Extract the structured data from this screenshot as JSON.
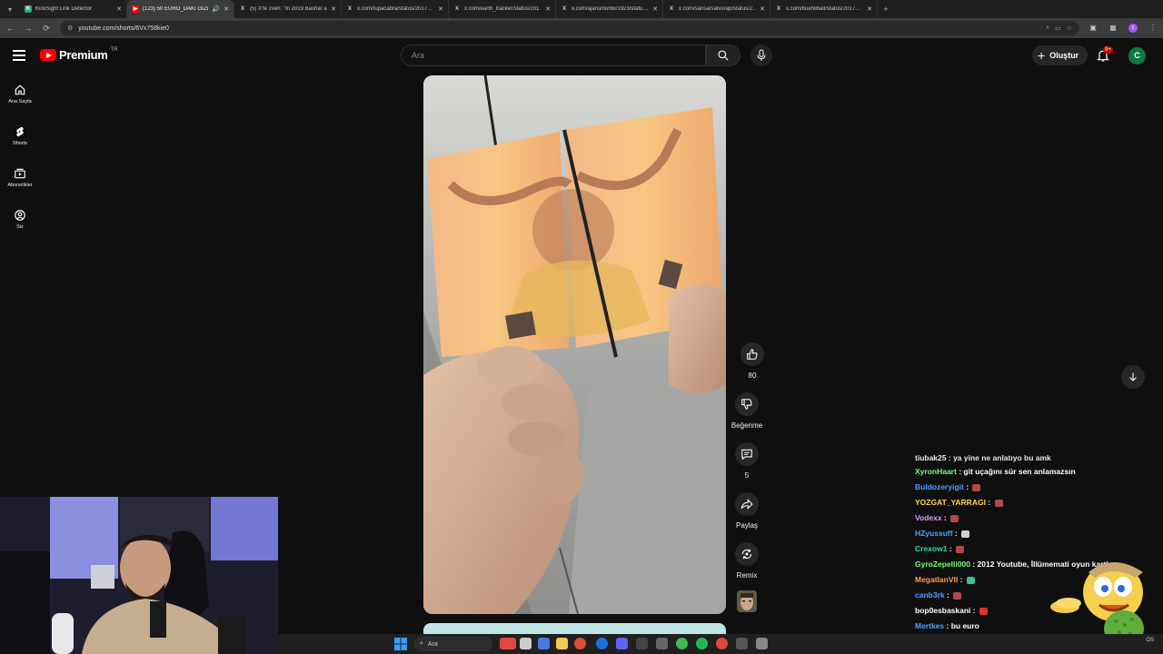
{
  "browser": {
    "tabs": [
      {
        "title": "KickSight Link Detector",
        "favicon": "K",
        "active": false
      },
      {
        "title": "(123) 50 EURO_DAKİ GİZLİ",
        "favicon": "▶",
        "active": true
      },
      {
        "title": "(5) X'te zven: \"In 2019 Bashar al",
        "favicon": "X",
        "active": false
      },
      {
        "title": "x.com/tupacabra/status/2017…",
        "favicon": "X",
        "active": false
      },
      {
        "title": "x.com/earth_tracker/status/201…",
        "favicon": "X",
        "active": false
      },
      {
        "title": "x.com/ajansmuhbir1923/statu…",
        "favicon": "X",
        "active": false
      },
      {
        "title": "x.com/sansarsalvorap/status/2…",
        "favicon": "X",
        "active": false
      },
      {
        "title": "x.com/buehlibait/status/2017…",
        "favicon": "X",
        "active": false
      }
    ],
    "new_tab": "+",
    "url": "youtube.com/shorts/6Vx758kie0"
  },
  "youtube": {
    "brand": "Premium",
    "region": "TR",
    "search_placeholder": "Ara",
    "create_label": "Oluştur",
    "notif_badge": "9+",
    "avatar_letter": "C"
  },
  "sidebar": {
    "items": [
      {
        "label": "Ana Sayfa",
        "icon": "home-icon"
      },
      {
        "label": "Shorts",
        "icon": "shorts-icon"
      },
      {
        "label": "Abonelikler",
        "icon": "subscriptions-icon"
      },
      {
        "label": "Siz",
        "icon": "you-icon"
      }
    ]
  },
  "actions": {
    "like_count": "80",
    "dislike_label": "Beğenme",
    "comment_count": "5",
    "share_label": "Paylaş",
    "remix_label": "Remix"
  },
  "chat": {
    "messages": [
      {
        "user": "tiubak25",
        "text": "ya yine ne anlatıyo bu amk",
        "color": "#ffffff",
        "emote": false
      },
      {
        "user": "XyronHaart",
        "text": "git uçağını sür sen anlamazsın",
        "color": "#7cfc7c",
        "emote": false
      },
      {
        "user": "Buldozeryigit",
        "text": "",
        "color": "#4fa3ff",
        "emote": true
      },
      {
        "user": "YOZGAT_YARRAGI",
        "text": "",
        "color": "#ffd84a",
        "emote": true
      },
      {
        "user": "Vodexx",
        "text": "",
        "color": "#e59cff",
        "emote": true
      },
      {
        "user": "HZyussuff",
        "text": "",
        "color": "#4fa3ff",
        "emote": true
      },
      {
        "user": "Crexow1",
        "text": "",
        "color": "#3ddc97",
        "emote": true
      },
      {
        "user": "GyroZepelli000",
        "text": "2012 Youtube, İllümemati oyun kartları",
        "color": "#7cfc7c",
        "emote": false
      },
      {
        "user": "MegatlanVII",
        "text": "",
        "color": "#ff9f40",
        "emote": true
      },
      {
        "user": "canb3rk",
        "text": "",
        "color": "#4fa3ff",
        "emote": true
      },
      {
        "user": "bop0esbaskani",
        "text": "",
        "color": "#ffffff",
        "emote": true
      },
      {
        "user": "Mertkes",
        "text": "bu euro",
        "color": "#4fa3ff",
        "emote": false
      }
    ]
  },
  "taskbar": {
    "search_placeholder": "Ara",
    "tray_text": "ÖS"
  },
  "colors": {
    "bg": "#0f0f0f",
    "accent_red": "#ff0000",
    "chip": "#272727"
  }
}
